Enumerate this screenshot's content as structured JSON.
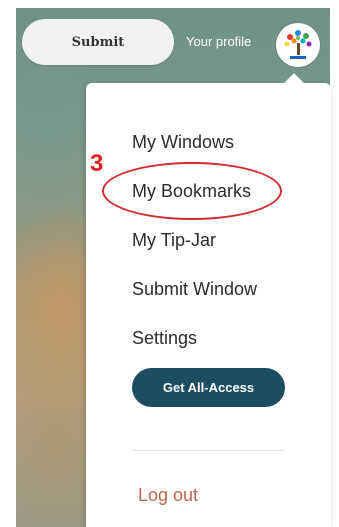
{
  "header": {
    "submit_label": "Submit",
    "profile_label": "Your profile",
    "avatar_icon": "tree-logo-icon"
  },
  "menu": {
    "items": [
      {
        "label": "My Windows"
      },
      {
        "label": "My Bookmarks"
      },
      {
        "label": "My Tip-Jar"
      },
      {
        "label": "Submit Window"
      },
      {
        "label": "Settings"
      }
    ],
    "cta_label": "Get All-Access",
    "logout_label": "Log out"
  },
  "annotation": {
    "step_number": "3",
    "highlight_color": "#d42a2a"
  },
  "colors": {
    "cta_background": "#1c4d62",
    "logout_text": "#c0674a"
  }
}
